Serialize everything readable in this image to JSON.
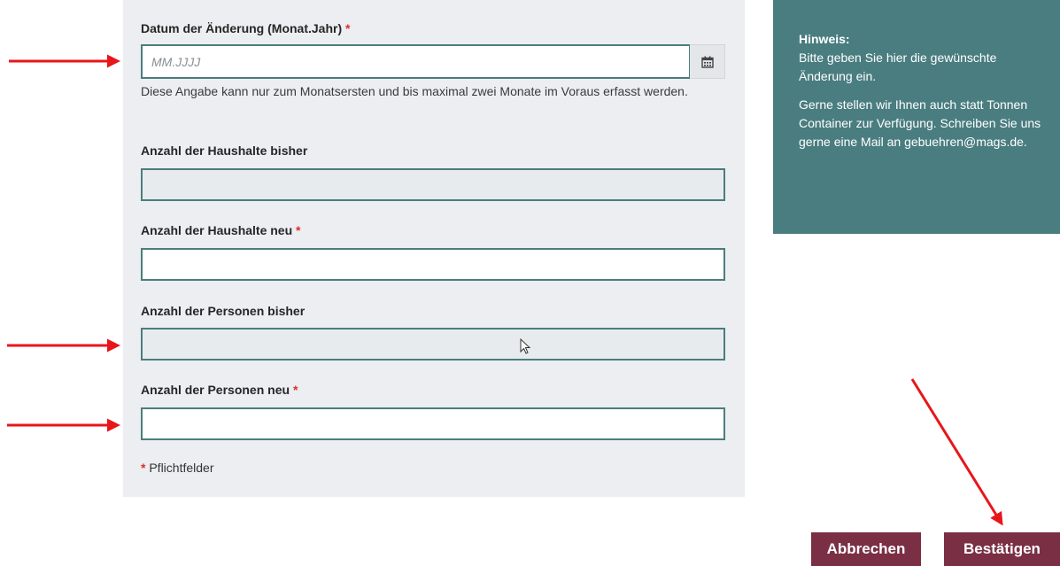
{
  "form": {
    "date_label": "Datum der Änderung (Monat.Jahr)",
    "required_mark": "*",
    "date_placeholder": "MM.JJJJ",
    "date_value": "",
    "date_help": "Diese Angabe kann nur zum Monatsersten und bis maximal zwei Monate im Voraus erfasst werden.",
    "households_old_label": "Anzahl der Haushalte bisher",
    "households_old_value": "",
    "households_new_label": "Anzahl der Haushalte neu",
    "households_new_value": "",
    "persons_old_label": "Anzahl der Personen bisher",
    "persons_old_value": "",
    "persons_new_label": "Anzahl der Personen neu",
    "persons_new_value": "",
    "mandatory_note": "Pflichtfelder"
  },
  "hint": {
    "title": "Hinweis:",
    "text1": "Bitte geben Sie hier die gewünschte Änderung ein.",
    "text2": "Gerne stellen wir Ihnen auch statt Tonnen Container zur Verfügung. Schreiben Sie uns gerne eine Mail an gebuehren@mags.de."
  },
  "buttons": {
    "cancel": "Abbrechen",
    "confirm": "Bestätigen"
  },
  "icons": {
    "calendar": "calendar-icon",
    "cursor": "mouse-pointer-icon",
    "annotation": "red-arrow"
  },
  "colors": {
    "accent": "#4a7d80",
    "button": "#7a2f45",
    "required": "#d9312b",
    "annotation": "#e8151a"
  }
}
